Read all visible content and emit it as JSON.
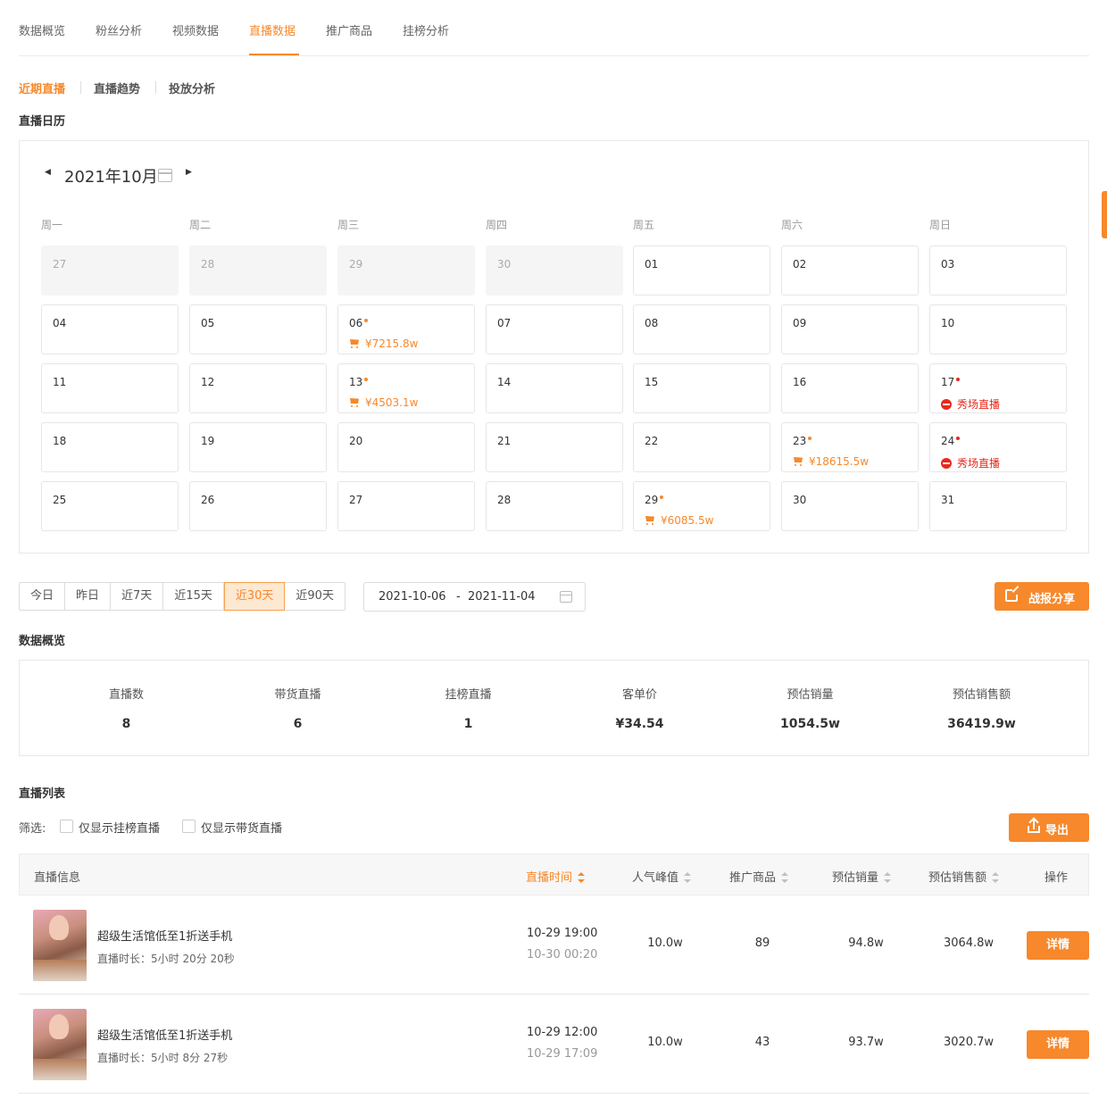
{
  "top_tabs": [
    "数据概览",
    "粉丝分析",
    "视频数据",
    "直播数据",
    "推广商品",
    "挂榜分析"
  ],
  "sub_tabs": [
    "近期直播",
    "直播趋势",
    "投放分析"
  ],
  "calendar": {
    "title": "直播日历",
    "month": "2021年10月",
    "weekdays": [
      "周一",
      "周二",
      "周三",
      "周四",
      "周五",
      "周六",
      "周日"
    ],
    "days": [
      {
        "num": "27",
        "other": true
      },
      {
        "num": "28",
        "other": true
      },
      {
        "num": "29",
        "other": true
      },
      {
        "num": "30",
        "other": true
      },
      {
        "num": "01"
      },
      {
        "num": "02"
      },
      {
        "num": "03"
      },
      {
        "num": "04"
      },
      {
        "num": "05"
      },
      {
        "num": "06",
        "dot": "orange",
        "kind": "sales",
        "text": "¥7215.8w"
      },
      {
        "num": "07"
      },
      {
        "num": "08"
      },
      {
        "num": "09"
      },
      {
        "num": "10"
      },
      {
        "num": "11"
      },
      {
        "num": "12"
      },
      {
        "num": "13",
        "dot": "orange",
        "kind": "sales",
        "text": "¥4503.1w"
      },
      {
        "num": "14"
      },
      {
        "num": "15"
      },
      {
        "num": "16"
      },
      {
        "num": "17",
        "dot": "red",
        "kind": "show",
        "text": "秀场直播"
      },
      {
        "num": "18"
      },
      {
        "num": "19"
      },
      {
        "num": "20"
      },
      {
        "num": "21"
      },
      {
        "num": "22"
      },
      {
        "num": "23",
        "dot": "orange",
        "kind": "sales",
        "text": "¥18615.5w"
      },
      {
        "num": "24",
        "dot": "red",
        "kind": "show",
        "text": "秀场直播"
      },
      {
        "num": "25"
      },
      {
        "num": "26"
      },
      {
        "num": "27"
      },
      {
        "num": "28"
      },
      {
        "num": "29",
        "dot": "orange",
        "kind": "sales",
        "text": "¥6085.5w"
      },
      {
        "num": "30"
      },
      {
        "num": "31"
      }
    ]
  },
  "ranges": [
    "今日",
    "昨日",
    "近7天",
    "近15天",
    "近30天",
    "近90天"
  ],
  "date_range": {
    "start": "2021-10-06",
    "dash": "-",
    "end": "2021-11-04"
  },
  "share_label": "战报分享",
  "overview": {
    "title": "数据概览",
    "items": [
      {
        "label": "直播数",
        "value": "8"
      },
      {
        "label": "带货直播",
        "value": "6"
      },
      {
        "label": "挂榜直播",
        "value": "1"
      },
      {
        "label": "客单价",
        "value": "¥34.54"
      },
      {
        "label": "预估销量",
        "value": "1054.5w"
      },
      {
        "label": "预估销售额",
        "value": "36419.9w"
      }
    ]
  },
  "list": {
    "title": "直播列表",
    "filter_label": "筛选:",
    "filter_options": [
      "仅显示挂榜直播",
      "仅显示带货直播"
    ],
    "export_label": "导出",
    "headers": {
      "info": "直播信息",
      "time": "直播时间",
      "popularity": "人气峰值",
      "products": "推广商品",
      "sales": "预估销量",
      "revenue": "预估销售额",
      "action": "操作"
    },
    "rows": [
      {
        "title": "超级生活馆低至1折送手机",
        "duration": "直播时长：5小时 20分 20秒",
        "start": "10-29 19:00",
        "end": "10-30 00:20",
        "popularity": "10.0w",
        "products": "89",
        "sales": "94.8w",
        "revenue": "3064.8w",
        "action": "详情"
      },
      {
        "title": "超级生活馆低至1折送手机",
        "duration": "直播时长：5小时 8分 27秒",
        "start": "10-29 12:00",
        "end": "10-29 17:09",
        "popularity": "10.0w",
        "products": "43",
        "sales": "93.7w",
        "revenue": "3020.7w",
        "action": "详情"
      }
    ]
  },
  "colors": {
    "accent": "#f7882b",
    "show_red": "#e8291d"
  }
}
